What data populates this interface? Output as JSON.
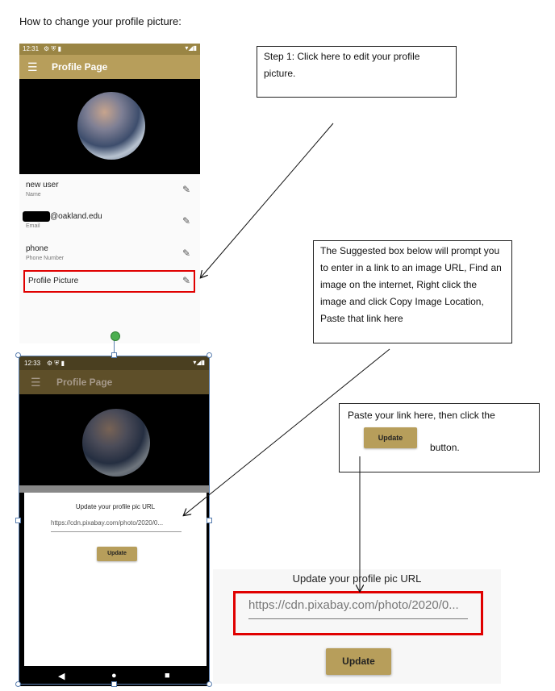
{
  "doc": {
    "title": "How to change your profile picture:"
  },
  "phone1": {
    "status": {
      "time": "12:31",
      "icons": "⚙ ⛨ ▮",
      "right": "▾◢▮"
    },
    "app_bar_title": "Profile Page",
    "fields": [
      {
        "value": "new user",
        "label": "Name"
      },
      {
        "value": "@oakland.edu",
        "label": "Email"
      },
      {
        "value": "phone",
        "label": "Phone Number"
      }
    ],
    "profile_picture_label": "Profile Picture"
  },
  "callouts": {
    "step1": "Step 1: Click here to edit your profile picture.",
    "step2": "The Suggested box below will prompt you to enter in a link to an image URL, Find an image on the internet, Right click the image and click Copy Image Location, Paste that link here",
    "step3_line1": "Paste your link here, then click the",
    "step3_button": "Update",
    "step3_line2": "button."
  },
  "phone2": {
    "status": {
      "time": "12:33",
      "icons": "⚙ ⛨ ▮",
      "right": "▾◢▮"
    },
    "app_bar_title": "Profile Page",
    "dialog_title": "Update your profile pic URL",
    "url_value": "https://cdn.pixabay.com/photo/2020/0...",
    "update_label": "Update",
    "nav": {
      "back": "◀",
      "home": "●",
      "recent": "■"
    }
  },
  "zoom": {
    "dialog_title": "Update your profile pic URL",
    "url_value": "https://cdn.pixabay.com/photo/2020/0...",
    "update_label": "Update"
  },
  "colors": {
    "accent": "#b79e5b",
    "highlight_red": "#e00000"
  }
}
